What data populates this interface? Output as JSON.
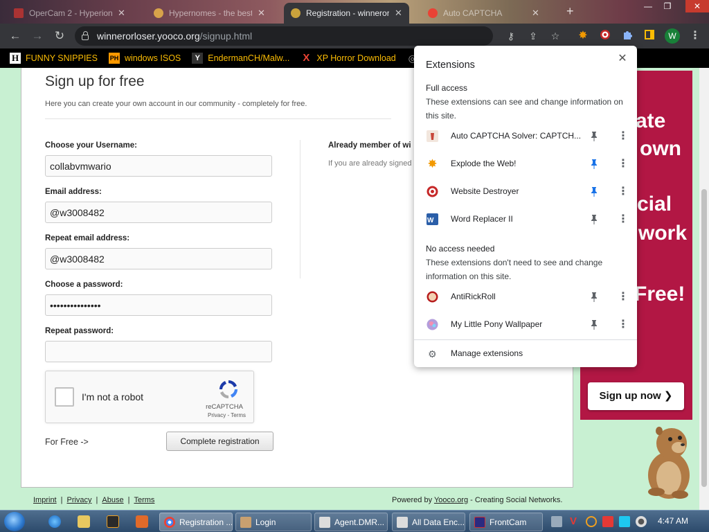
{
  "tabs": [
    {
      "title": "OperCam 2 - Hyperion",
      "active": false
    },
    {
      "title": "Hypernomes - the best s",
      "active": false
    },
    {
      "title": "Registration - winnerorl",
      "active": true
    },
    {
      "title": "Auto CAPTCHA",
      "active": false
    }
  ],
  "toolbar": {
    "url_host": "winnerorloser.yooco.org",
    "url_path": "/signup.html",
    "profile_initial": "W"
  },
  "bookmarks": [
    {
      "label": "FUNNY SNIPPIES",
      "icon_text": "H"
    },
    {
      "label": "windows ISOS",
      "icon_text": "PH"
    },
    {
      "label": "EndermanCH/Malw...",
      "icon_text": "Y"
    },
    {
      "label": "XP Horror Download",
      "icon_text": "X"
    },
    {
      "label": "m",
      "icon_text": "◎"
    }
  ],
  "signup": {
    "title": "Sign up for free",
    "subtitle": "Here you can create your own account in our community - completely for free.",
    "username_label": "Choose your Username:",
    "username_value": "collabvmwario",
    "email_label": "Email address:",
    "email_value": "@w3008482",
    "repeat_email_label": "Repeat email address:",
    "repeat_email_value": "@w3008482",
    "password_label": "Choose a password:",
    "password_value": "•••••••••••••••",
    "repeat_password_label": "Repeat password:",
    "repeat_password_value": "",
    "captcha_text": "I'm not a robot",
    "captcha_brand": "reCAPTCHA",
    "captcha_links": "Privacy - Terms",
    "for_free": "For Free ->",
    "complete_button": "Complete registration",
    "member_heading": "Already member of wi",
    "member_text": "If you are already signed"
  },
  "promo": {
    "lines": [
      "ate",
      "own",
      "cial",
      "work",
      "Free!"
    ],
    "button": "Sign up now ❯"
  },
  "footer": {
    "links": [
      "Imprint",
      "Privacy",
      "Abuse",
      "Terms"
    ],
    "powered_prefix": "Powered by ",
    "powered_link": "Yooco.org",
    "powered_suffix": " - Creating Social Networks."
  },
  "extensions_popup": {
    "title": "Extensions",
    "full_access_title": "Full access",
    "full_access_desc": "These extensions can see and change information on this site.",
    "full_access_items": [
      {
        "name": "Auto CAPTCHA Solver: CAPTCH...",
        "pinned": false
      },
      {
        "name": "Explode the Web!",
        "pinned": true
      },
      {
        "name": "Website Destroyer",
        "pinned": true
      },
      {
        "name": "Word Replacer II",
        "pinned": false
      }
    ],
    "no_access_title": "No access needed",
    "no_access_desc": "These extensions don't need to see and change information on this site.",
    "no_access_items": [
      {
        "name": "AntiRickRoll",
        "pinned": false
      },
      {
        "name": "My Little Pony Wallpaper",
        "pinned": false
      }
    ],
    "manage": "Manage extensions"
  },
  "taskbar": {
    "tasks": [
      {
        "label": "Registration ...",
        "active": true
      },
      {
        "label": "Login",
        "active": false
      },
      {
        "label": "Agent.DMR...",
        "active": false
      },
      {
        "label": "All Data Enc...",
        "active": false
      },
      {
        "label": "FrontCam",
        "active": false
      }
    ],
    "clock": "4:47 AM"
  },
  "colors": {
    "page_bg": "#c8f0d2",
    "promo": "#b21744",
    "bookmark_text": "#fbbc04",
    "pin_active": "#1a73e8"
  }
}
